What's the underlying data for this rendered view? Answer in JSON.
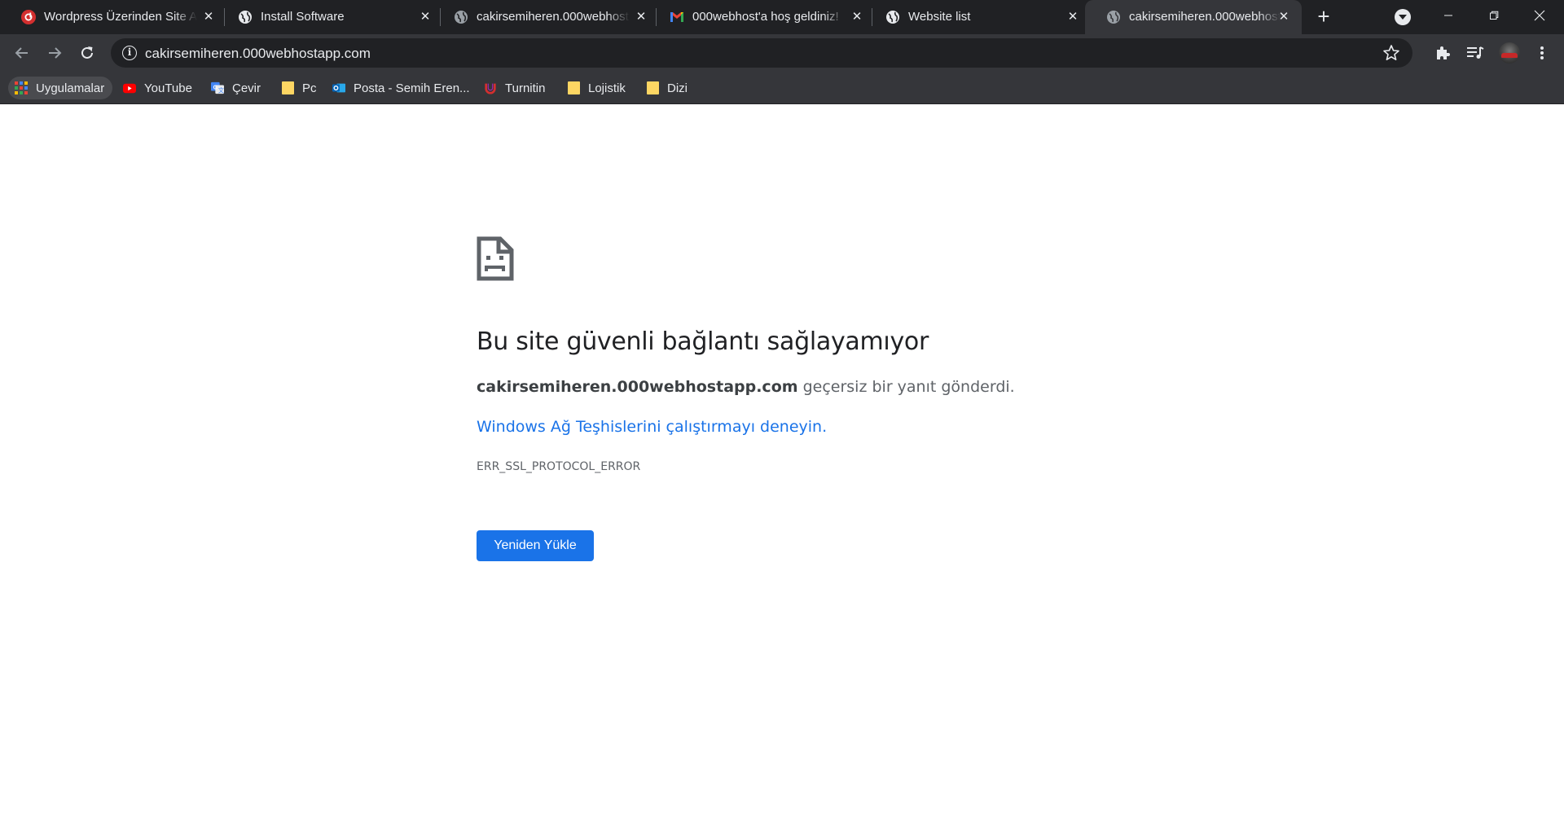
{
  "tabs": [
    {
      "title": "Wordpress Üzerinden Site A",
      "favicon": "wordpress-red-icon",
      "active": false
    },
    {
      "title": "Install Software",
      "favicon": "globe-icon",
      "active": false
    },
    {
      "title": "cakirsemiheren.000webhost",
      "favicon": "globe-icon",
      "active": false
    },
    {
      "title": "000webhost'a hoş geldiniz!",
      "favicon": "gmail-icon",
      "active": false
    },
    {
      "title": "Website list",
      "favicon": "globe-icon",
      "active": false
    },
    {
      "title": "cakirsemiheren.000webhost",
      "favicon": "globe-icon",
      "active": true
    }
  ],
  "omnibox": {
    "url": "cakirsemiheren.000webhostapp.com"
  },
  "bookmarks": [
    {
      "label": "Uygulamalar",
      "icon": "apps-grid-icon"
    },
    {
      "label": "YouTube",
      "icon": "youtube-icon"
    },
    {
      "label": "Çevir",
      "icon": "translate-icon"
    },
    {
      "label": "Pc",
      "icon": "folder-icon"
    },
    {
      "label": "Posta - Semih Eren...",
      "icon": "outlook-icon"
    },
    {
      "label": "Turnitin",
      "icon": "turnitin-icon"
    },
    {
      "label": "Lojistik",
      "icon": "folder-icon"
    },
    {
      "label": "Dizi",
      "icon": "folder-icon"
    }
  ],
  "error": {
    "title": "Bu site güvenli bağlantı sağlayamıyor",
    "host": "cakirsemiheren.000webhostapp.com",
    "desc_suffix": " geçersiz bir yanıt gönderdi.",
    "link": "Windows Ağ Teşhislerini çalıştırmayı deneyin.",
    "code": "ERR_SSL_PROTOCOL_ERROR",
    "reload_label": "Yeniden Yükle"
  },
  "colors": {
    "tabstrip_bg": "#202124",
    "toolbar_bg": "#35363a",
    "accent_blue": "#1a73e8",
    "title_text": "#202124"
  }
}
